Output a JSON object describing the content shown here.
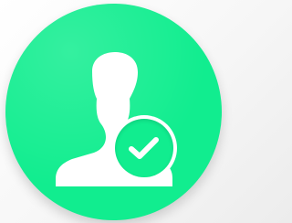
{
  "icon": {
    "name": "user-verified-icon",
    "background_color": "#11ed8f",
    "glyph_color": "#ffffff",
    "badge_icon": "checkmark-icon"
  }
}
